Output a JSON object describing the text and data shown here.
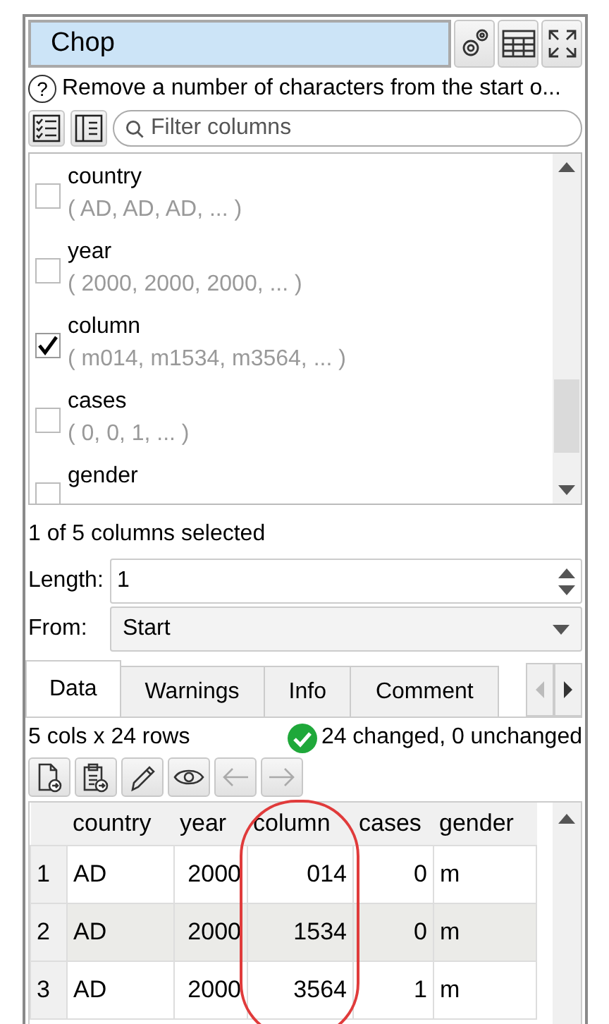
{
  "title_bar": {
    "title": "Chop"
  },
  "help": {
    "glyph": "?",
    "text": "Remove a number of characters from the start o..."
  },
  "filter": {
    "placeholder": "Filter columns"
  },
  "columns_list": [
    {
      "name": "country",
      "sample": "( AD, AD, AD, ... )",
      "checked": false
    },
    {
      "name": "year",
      "sample": "( 2000, 2000, 2000, ... )",
      "checked": false
    },
    {
      "name": "column",
      "sample": "( m014, m1534, m3564, ... )",
      "checked": true
    },
    {
      "name": "cases",
      "sample": "( 0, 0, 1, ... )",
      "checked": false
    },
    {
      "name": "gender",
      "checked": false
    }
  ],
  "selection_summary": "1 of 5 columns selected",
  "length": {
    "label": "Length:",
    "value": "1"
  },
  "from": {
    "label": "From:",
    "value": "Start"
  },
  "tabs": [
    {
      "label": "Data",
      "selected": true
    },
    {
      "label": "Warnings",
      "selected": false
    },
    {
      "label": "Info",
      "selected": false
    },
    {
      "label": "Comment",
      "selected": false
    }
  ],
  "tab_scroll": {
    "back_disabled": true,
    "forward_disabled": false
  },
  "status": {
    "dimensions": "5 cols x 24 rows",
    "result": "24 changed, 0 unchanged",
    "ok": true
  },
  "toolbar": [
    {
      "kind": "export",
      "disabled": false
    },
    {
      "kind": "paste",
      "disabled": false
    },
    {
      "kind": "edit",
      "disabled": false
    },
    {
      "kind": "view",
      "disabled": false
    },
    {
      "kind": "back",
      "disabled": true
    },
    {
      "kind": "forward",
      "disabled": true
    }
  ],
  "table": {
    "columns": [
      {
        "label": "country",
        "kind": "text",
        "highlighted": false
      },
      {
        "label": "year",
        "kind": "number",
        "highlighted": false
      },
      {
        "label": "column",
        "kind": "number",
        "highlighted": true
      },
      {
        "label": "cases",
        "kind": "number",
        "highlighted": false
      },
      {
        "label": "gender",
        "kind": "text",
        "highlighted": false
      }
    ],
    "rows": [
      {
        "index": "1",
        "cells": [
          "AD",
          "2000",
          "014",
          "0",
          "m"
        ]
      },
      {
        "index": "2",
        "cells": [
          "AD",
          "2000",
          "1534",
          "0",
          "m"
        ]
      },
      {
        "index": "3",
        "cells": [
          "AD",
          "2000",
          "3564",
          "1",
          "m"
        ]
      }
    ]
  }
}
